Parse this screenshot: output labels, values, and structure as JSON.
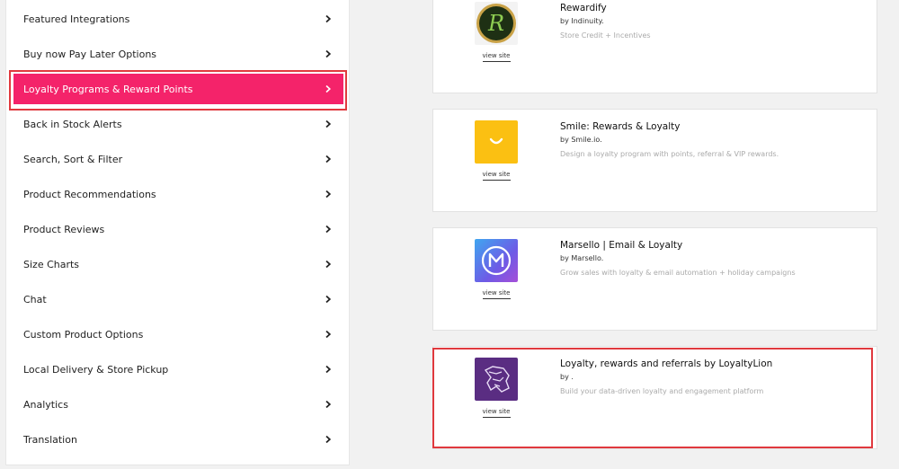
{
  "sidebar": {
    "items": [
      {
        "label": "Featured Integrations"
      },
      {
        "label": "Buy now Pay Later Options"
      },
      {
        "label": "Loyalty Programs & Reward Points",
        "active": true
      },
      {
        "label": "Back in Stock Alerts"
      },
      {
        "label": "Search, Sort & Filter"
      },
      {
        "label": "Product Recommendations"
      },
      {
        "label": "Product Reviews"
      },
      {
        "label": "Size Charts"
      },
      {
        "label": "Chat"
      },
      {
        "label": "Custom Product Options"
      },
      {
        "label": "Local Delivery & Store Pickup"
      },
      {
        "label": "Analytics"
      },
      {
        "label": "Translation"
      }
    ],
    "chevron_icon": "chevron-right-icon",
    "active_color": "#f4236a"
  },
  "apps": [
    {
      "title": "Rewardify",
      "by": "by Indinuity.",
      "description": "Store Credit + Incentives",
      "link": "view site",
      "logo_icon": "rewardify-r-logo",
      "logo_bg": "#2a4a1e"
    },
    {
      "title": "Smile: Rewards & Loyalty",
      "by": "by Smile.io.",
      "description": "Design a loyalty program with points, referral & VIP rewards.",
      "link": "view site",
      "logo_icon": "smile-logo",
      "logo_bg": "#fbc012"
    },
    {
      "title": "Marsello | Email & Loyalty",
      "by": "by Marsello.",
      "description": "Grow sales with loyalty & email automation + holiday campaigns",
      "link": "view site",
      "logo_icon": "marsello-m-logo",
      "logo_bg": "#5b6ee8"
    },
    {
      "title": "Loyalty, rewards and referrals by LoyaltyLion",
      "by": "by .",
      "description": "Build your data-driven loyalty and engagement platform",
      "link": "view site",
      "logo_icon": "loyaltylion-logo",
      "logo_bg": "#5a2d82"
    }
  ],
  "highlight_color": "#e0393e"
}
